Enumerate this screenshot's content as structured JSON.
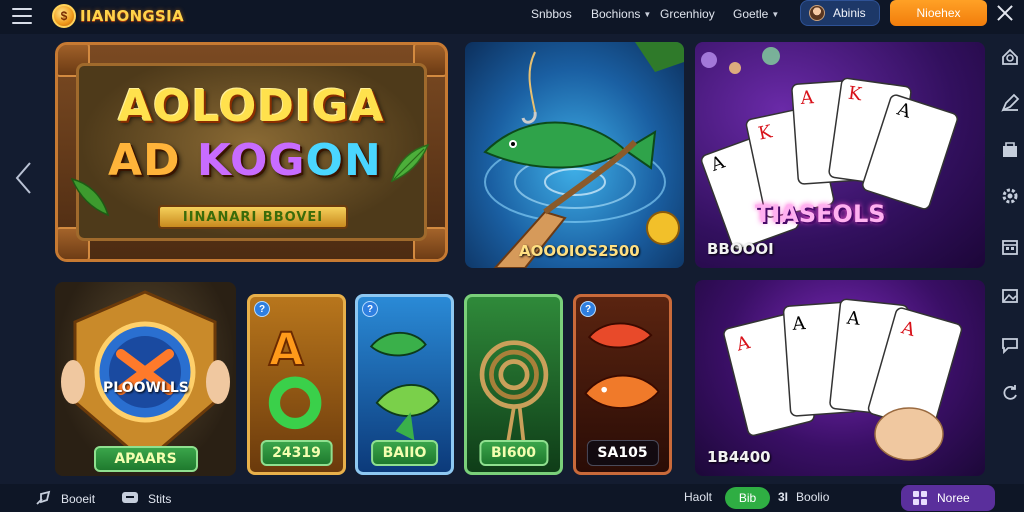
{
  "header": {
    "logo_text": "IIANONGSIA",
    "nav": [
      {
        "label": "Snbbos",
        "has_dropdown": false
      },
      {
        "label": "Bochions",
        "has_dropdown": true
      },
      {
        "label": "Grcenhioy",
        "has_dropdown": false
      },
      {
        "label": "Goetle",
        "has_dropdown": true
      }
    ],
    "user_button_label": "Abinis",
    "cta_button_label": "Nioehex"
  },
  "banner": {
    "title_line1": "AOLODIGA",
    "title_line2_a": "AD ",
    "title_line2_b": "KOG",
    "title_line2_c": "ON",
    "subtitle": "IINANARI BBOVEI"
  },
  "games": {
    "fish_label": "AOOOIOS2500",
    "cards_label": "BBOOOI",
    "shield_label": "APAARS",
    "shield_center_text": "PLOOWLLS",
    "cards_center_text": "TIASEOLS",
    "tile_a_label": "24319",
    "tile_b_label": "BAIIO",
    "tile_c_label": "BI600",
    "tile_d_label": "SA105",
    "cards2_label": "1B4400",
    "tile_badge": "?"
  },
  "sidebar_right": {
    "icons": [
      "home-icon",
      "edit-icon",
      "store-icon",
      "settings-icon",
      "calendar-icon",
      "image-icon",
      "chat-icon",
      "refresh-icon"
    ]
  },
  "footer": {
    "item1_label": "Booeit",
    "item2_label": "Stits",
    "text_a": "Haolt",
    "green_pill_label": "Bib",
    "counter_prefix": "3I",
    "text_b": "Boolio",
    "purple_button_label": "Noree"
  },
  "colors": {
    "background": "#131c30",
    "topbar": "#0e1626",
    "accent_orange": "#f7901a",
    "accent_blue": "#1d3868",
    "accent_green": "#2fae43",
    "accent_purple": "#5a2f9c"
  }
}
